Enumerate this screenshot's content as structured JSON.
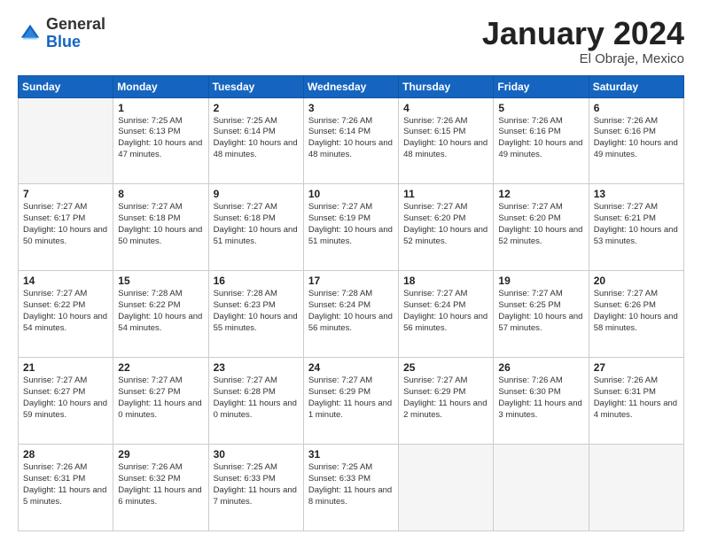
{
  "header": {
    "logo_general": "General",
    "logo_blue": "Blue",
    "month_title": "January 2024",
    "location": "El Obraje, Mexico"
  },
  "days_of_week": [
    "Sunday",
    "Monday",
    "Tuesday",
    "Wednesday",
    "Thursday",
    "Friday",
    "Saturday"
  ],
  "weeks": [
    [
      {
        "day": "",
        "info": ""
      },
      {
        "day": "1",
        "info": "Sunrise: 7:25 AM\nSunset: 6:13 PM\nDaylight: 10 hours\nand 47 minutes."
      },
      {
        "day": "2",
        "info": "Sunrise: 7:25 AM\nSunset: 6:14 PM\nDaylight: 10 hours\nand 48 minutes."
      },
      {
        "day": "3",
        "info": "Sunrise: 7:26 AM\nSunset: 6:14 PM\nDaylight: 10 hours\nand 48 minutes."
      },
      {
        "day": "4",
        "info": "Sunrise: 7:26 AM\nSunset: 6:15 PM\nDaylight: 10 hours\nand 48 minutes."
      },
      {
        "day": "5",
        "info": "Sunrise: 7:26 AM\nSunset: 6:16 PM\nDaylight: 10 hours\nand 49 minutes."
      },
      {
        "day": "6",
        "info": "Sunrise: 7:26 AM\nSunset: 6:16 PM\nDaylight: 10 hours\nand 49 minutes."
      }
    ],
    [
      {
        "day": "7",
        "info": "Sunrise: 7:27 AM\nSunset: 6:17 PM\nDaylight: 10 hours\nand 50 minutes."
      },
      {
        "day": "8",
        "info": "Sunrise: 7:27 AM\nSunset: 6:18 PM\nDaylight: 10 hours\nand 50 minutes."
      },
      {
        "day": "9",
        "info": "Sunrise: 7:27 AM\nSunset: 6:18 PM\nDaylight: 10 hours\nand 51 minutes."
      },
      {
        "day": "10",
        "info": "Sunrise: 7:27 AM\nSunset: 6:19 PM\nDaylight: 10 hours\nand 51 minutes."
      },
      {
        "day": "11",
        "info": "Sunrise: 7:27 AM\nSunset: 6:20 PM\nDaylight: 10 hours\nand 52 minutes."
      },
      {
        "day": "12",
        "info": "Sunrise: 7:27 AM\nSunset: 6:20 PM\nDaylight: 10 hours\nand 52 minutes."
      },
      {
        "day": "13",
        "info": "Sunrise: 7:27 AM\nSunset: 6:21 PM\nDaylight: 10 hours\nand 53 minutes."
      }
    ],
    [
      {
        "day": "14",
        "info": "Sunrise: 7:27 AM\nSunset: 6:22 PM\nDaylight: 10 hours\nand 54 minutes."
      },
      {
        "day": "15",
        "info": "Sunrise: 7:28 AM\nSunset: 6:22 PM\nDaylight: 10 hours\nand 54 minutes."
      },
      {
        "day": "16",
        "info": "Sunrise: 7:28 AM\nSunset: 6:23 PM\nDaylight: 10 hours\nand 55 minutes."
      },
      {
        "day": "17",
        "info": "Sunrise: 7:28 AM\nSunset: 6:24 PM\nDaylight: 10 hours\nand 56 minutes."
      },
      {
        "day": "18",
        "info": "Sunrise: 7:27 AM\nSunset: 6:24 PM\nDaylight: 10 hours\nand 56 minutes."
      },
      {
        "day": "19",
        "info": "Sunrise: 7:27 AM\nSunset: 6:25 PM\nDaylight: 10 hours\nand 57 minutes."
      },
      {
        "day": "20",
        "info": "Sunrise: 7:27 AM\nSunset: 6:26 PM\nDaylight: 10 hours\nand 58 minutes."
      }
    ],
    [
      {
        "day": "21",
        "info": "Sunrise: 7:27 AM\nSunset: 6:27 PM\nDaylight: 10 hours\nand 59 minutes."
      },
      {
        "day": "22",
        "info": "Sunrise: 7:27 AM\nSunset: 6:27 PM\nDaylight: 11 hours\nand 0 minutes."
      },
      {
        "day": "23",
        "info": "Sunrise: 7:27 AM\nSunset: 6:28 PM\nDaylight: 11 hours\nand 0 minutes."
      },
      {
        "day": "24",
        "info": "Sunrise: 7:27 AM\nSunset: 6:29 PM\nDaylight: 11 hours\nand 1 minute."
      },
      {
        "day": "25",
        "info": "Sunrise: 7:27 AM\nSunset: 6:29 PM\nDaylight: 11 hours\nand 2 minutes."
      },
      {
        "day": "26",
        "info": "Sunrise: 7:26 AM\nSunset: 6:30 PM\nDaylight: 11 hours\nand 3 minutes."
      },
      {
        "day": "27",
        "info": "Sunrise: 7:26 AM\nSunset: 6:31 PM\nDaylight: 11 hours\nand 4 minutes."
      }
    ],
    [
      {
        "day": "28",
        "info": "Sunrise: 7:26 AM\nSunset: 6:31 PM\nDaylight: 11 hours\nand 5 minutes."
      },
      {
        "day": "29",
        "info": "Sunrise: 7:26 AM\nSunset: 6:32 PM\nDaylight: 11 hours\nand 6 minutes."
      },
      {
        "day": "30",
        "info": "Sunrise: 7:25 AM\nSunset: 6:33 PM\nDaylight: 11 hours\nand 7 minutes."
      },
      {
        "day": "31",
        "info": "Sunrise: 7:25 AM\nSunset: 6:33 PM\nDaylight: 11 hours\nand 8 minutes."
      },
      {
        "day": "",
        "info": ""
      },
      {
        "day": "",
        "info": ""
      },
      {
        "day": "",
        "info": ""
      }
    ]
  ]
}
